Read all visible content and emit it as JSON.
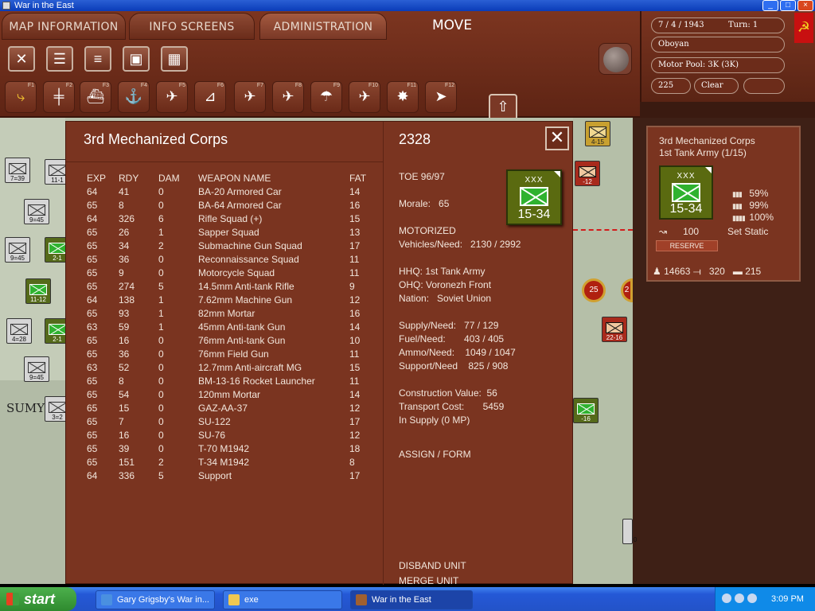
{
  "window": {
    "title": "War in the East"
  },
  "tabs": [
    {
      "label": "MAP INFORMATION"
    },
    {
      "label": "INFO SCREENS"
    },
    {
      "label": "ADMINISTRATION"
    }
  ],
  "mode_label": "MOVE",
  "toolbar_icons": [
    "close-icon",
    "list-icon",
    "document-list-icon",
    "save-icon",
    "grid-icon"
  ],
  "function_keys": [
    {
      "key": "F1",
      "icon": "move-path-icon"
    },
    {
      "key": "F2",
      "icon": "railroad-icon"
    },
    {
      "key": "F3",
      "icon": "naval-transport-icon"
    },
    {
      "key": "F4",
      "icon": "ship-icon"
    },
    {
      "key": "F5",
      "icon": "air-recon-icon"
    },
    {
      "key": "F6",
      "icon": "airfield-icon"
    },
    {
      "key": "F7",
      "icon": "air-transfer-icon"
    },
    {
      "key": "F8",
      "icon": "air-bombing-icon"
    },
    {
      "key": "F9",
      "icon": "paradrop-icon"
    },
    {
      "key": "F10",
      "icon": "air-attack-icon"
    },
    {
      "key": "F11",
      "icon": "explosion-icon"
    },
    {
      "key": "F12",
      "icon": "next-unit-icon"
    }
  ],
  "status": {
    "date": "7 / 4 / 1943",
    "turn": "Turn: 1",
    "location": "Oboyan",
    "motor_pool": "Motor Pool: 3K (3K)",
    "value": "225",
    "weather": "Clear"
  },
  "map": {
    "city_label": "SUMY",
    "counters": [
      {
        "label": "7=39",
        "style": "sov"
      },
      {
        "label": "11-1",
        "style": "sov"
      },
      {
        "label": "9=45",
        "style": "sov"
      },
      {
        "label": "9=45",
        "style": "sov"
      },
      {
        "label": "2-1",
        "style": "green"
      },
      {
        "label": "11-12",
        "style": "green"
      },
      {
        "label": "4=28",
        "style": "sov"
      },
      {
        "label": "2-1",
        "style": "green"
      },
      {
        "label": "9=45",
        "style": "sov"
      },
      {
        "label": "3=2",
        "style": "sov"
      },
      {
        "label": "4-15",
        "style": "gold"
      },
      {
        "label": "-12",
        "style": "red"
      },
      {
        "label": "22-16",
        "style": "red"
      },
      {
        "label": "-16",
        "style": "green"
      },
      {
        "label": "0",
        "style": "sov"
      }
    ],
    "markers": [
      "25",
      "2"
    ]
  },
  "unit_panel": {
    "name": "3rd Mechanized Corps",
    "id": "2328",
    "columns": [
      "EXP",
      "RDY",
      "DAM",
      "WEAPON NAME",
      "FAT"
    ],
    "rows": [
      [
        "64",
        "41",
        "0",
        "BA-20 Armored Car",
        "14"
      ],
      [
        "65",
        "8",
        "0",
        "BA-64 Armored Car",
        "16"
      ],
      [
        "64",
        "326",
        "6",
        "Rifle Squad (+)",
        "15"
      ],
      [
        "65",
        "26",
        "1",
        "Sapper Squad",
        "13"
      ],
      [
        "65",
        "34",
        "2",
        "Submachine Gun Squad",
        "17"
      ],
      [
        "65",
        "36",
        "0",
        "Reconnaissance Squad",
        "11"
      ],
      [
        "65",
        "9",
        "0",
        "Motorcycle Squad",
        "11"
      ],
      [
        "65",
        "274",
        "5",
        "14.5mm Anti-tank Rifle",
        "9"
      ],
      [
        "64",
        "138",
        "1",
        "7.62mm Machine Gun",
        "12"
      ],
      [
        "65",
        "93",
        "1",
        "82mm Mortar",
        "16"
      ],
      [
        "63",
        "59",
        "1",
        "45mm Anti-tank Gun",
        "14"
      ],
      [
        "65",
        "16",
        "0",
        "76mm Anti-tank Gun",
        "10"
      ],
      [
        "65",
        "36",
        "0",
        "76mm Field Gun",
        "11"
      ],
      [
        "63",
        "52",
        "0",
        "12.7mm Anti-aircraft MG",
        "15"
      ],
      [
        "65",
        "8",
        "0",
        "BM-13-16 Rocket Launcher",
        "11"
      ],
      [
        "65",
        "54",
        "0",
        "120mm Mortar",
        "14"
      ],
      [
        "65",
        "15",
        "0",
        "GAZ-AA-37",
        "12"
      ],
      [
        "65",
        "7",
        "0",
        "SU-122",
        "17"
      ],
      [
        "65",
        "16",
        "0",
        "SU-76",
        "12"
      ],
      [
        "65",
        "39",
        "0",
        "T-70 M1942",
        "18"
      ],
      [
        "65",
        "151",
        "2",
        "T-34 M1942",
        "8"
      ],
      [
        "64",
        "336",
        "5",
        "Support",
        "17"
      ]
    ],
    "toe": "TOE 96/97",
    "morale": "Morale:   65",
    "type": "MOTORIZED",
    "vehicles": "Vehicles/Need:   2130 / 2992",
    "hhq": "HHQ: 1st Tank Army",
    "ohq": "OHQ: Voronezh Front",
    "nation": "Nation:   Soviet Union",
    "supply": "Supply/Need:   77 / 129",
    "fuel": "Fuel/Need:       403 / 405",
    "ammo": "Ammo/Need:    1049 / 1047",
    "support": "Support/Need    825 / 908",
    "construction": "Construction Value:  56",
    "transport": "Transport Cost:       5459",
    "in_supply": "In Supply (0 MP)",
    "assign": "ASSIGN / FORM",
    "disband": "DISBAND UNIT",
    "merge": "MERGE UNIT",
    "counter": {
      "size": "XXX",
      "strength": "15-34"
    }
  },
  "side_box": {
    "name": "3rd Mechanized Corps",
    "army": "1st Tank Army (1/15)",
    "counter": {
      "size": "XXX",
      "strength": "15-34"
    },
    "pcts": [
      "59%",
      "99%",
      "100%"
    ],
    "mp": "100",
    "static": "Set Static",
    "reserve": "RESERVE",
    "men": "14663",
    "guns": "320",
    "tanks": "215"
  },
  "taskbar": {
    "start": "start",
    "items": [
      "Gary Grigsby's War in...",
      "exe",
      "War in the East"
    ],
    "clock": "3:09 PM"
  }
}
